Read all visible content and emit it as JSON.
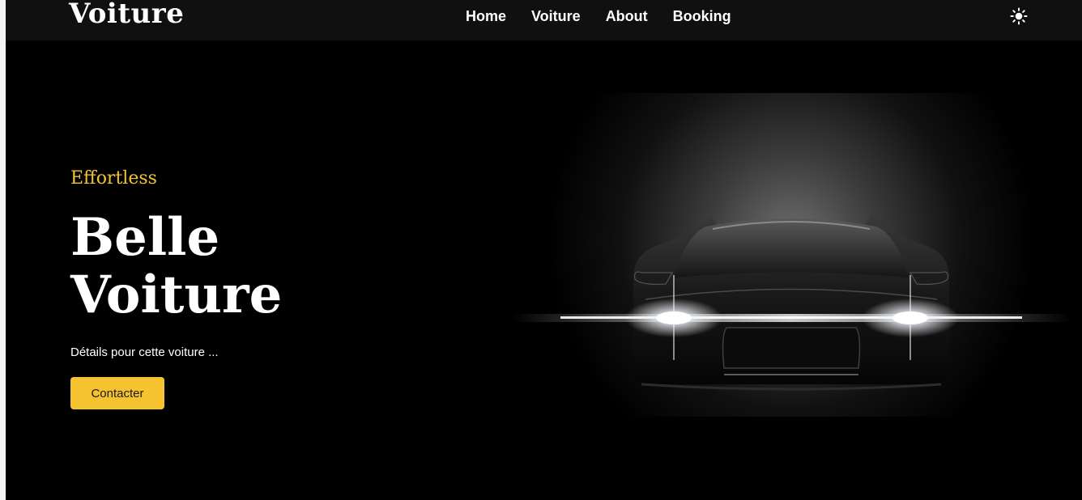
{
  "navbar": {
    "brand": "Voiture",
    "links": [
      "Home",
      "Voiture",
      "About",
      "Booking"
    ],
    "theme_icon": "sun-icon"
  },
  "hero": {
    "eyebrow": "Effortless",
    "title_line1": "Belle",
    "title_line2": "Voiture",
    "subtitle": "Détails pour cette voiture ...",
    "cta_label": "Contacter"
  },
  "colors": {
    "background": "#000000",
    "navbar": "#101010",
    "accent": "#f5c230",
    "text": "#ffffff"
  },
  "image": {
    "subject": "car-headlights-illustration"
  }
}
